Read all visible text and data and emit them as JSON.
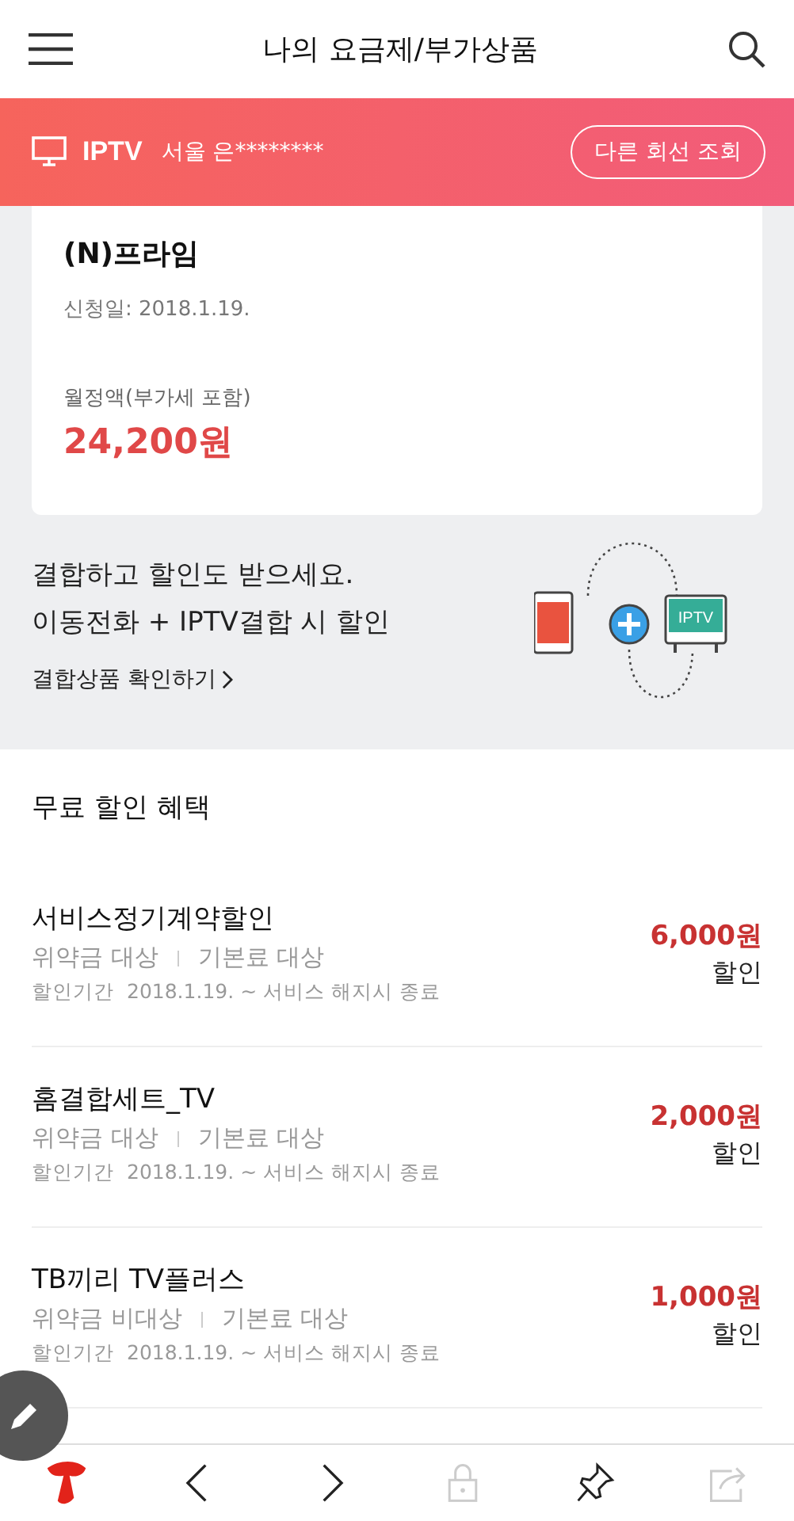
{
  "header": {
    "title": "나의 요금제/부가상품"
  },
  "line_bar": {
    "service": "IPTV",
    "line": "서울 은********",
    "button": "다른 회선 조회"
  },
  "plan_card": {
    "name": "(N)프라임",
    "signup": "신청일: 2018.1.19.",
    "fee_label": "월정액(부가세 포함)",
    "fee": "24,200원"
  },
  "promo": {
    "lines": [
      "결합하고 할인도 받으세요.",
      "이동전화 + IPTV결합 시 할인"
    ],
    "link": "결합상품 확인하기",
    "tv_label": "IPTV"
  },
  "discounts": {
    "title": "무료 할인 혜택",
    "items": [
      {
        "name": "서비스정기계약할인",
        "tags": [
          "위약금 대상",
          "기본료 대상"
        ],
        "period_label": "할인기간",
        "period": "2018.1.19. ~ 서비스 해지시 종료",
        "amount": "6,000원",
        "unit": "할인"
      },
      {
        "name": "홈결합세트_TV",
        "tags": [
          "위약금 대상",
          "기본료 대상"
        ],
        "period_label": "할인기간",
        "period": "2018.1.19. ~ 서비스 해지시 종료",
        "amount": "2,000원",
        "unit": "할인"
      },
      {
        "name": "TB끼리 TV플러스",
        "tags": [
          "위약금 비대상",
          "기본료 대상"
        ],
        "period_label": "할인기간",
        "period": "2018.1.19. ~ 서비스 해지시 종료",
        "amount": "1,000원",
        "unit": "할인"
      }
    ]
  },
  "toolbar": [
    {
      "kind": "home",
      "disabled": false
    },
    {
      "kind": "back",
      "disabled": false
    },
    {
      "kind": "forward",
      "disabled": false
    },
    {
      "kind": "lock",
      "disabled": true
    },
    {
      "kind": "pin",
      "disabled": false
    },
    {
      "kind": "share",
      "disabled": true
    }
  ]
}
